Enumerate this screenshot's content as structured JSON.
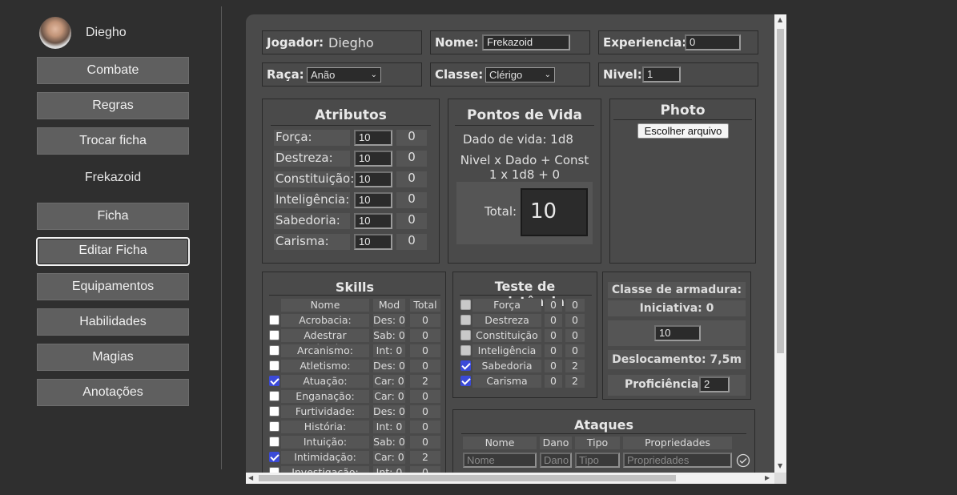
{
  "sidebar": {
    "user_name": "Diegho",
    "items": [
      {
        "label": "Combate"
      },
      {
        "label": "Regras"
      },
      {
        "label": "Trocar ficha"
      }
    ],
    "character_name": "Frekazoid",
    "char_items": [
      {
        "label": "Ficha"
      },
      {
        "label": "Editar Ficha"
      },
      {
        "label": "Equipamentos"
      },
      {
        "label": "Habilidades"
      },
      {
        "label": "Magias"
      },
      {
        "label": "Anotações"
      }
    ]
  },
  "header": {
    "player_label": "Jogador:",
    "player_value": "Diegho",
    "name_label": "Nome:",
    "name_value": "Frekazoid",
    "xp_label": "Experiencia:",
    "xp_value": "0",
    "race_label": "Raça:",
    "race_value": "Anão",
    "class_label": "Classe:",
    "class_value": "Clérigo",
    "level_label": "Nivel:",
    "level_value": "1"
  },
  "attributes": {
    "title": "Atributos",
    "rows": [
      {
        "label": "Força:",
        "value": "10",
        "mod": "0"
      },
      {
        "label": "Destreza:",
        "value": "10",
        "mod": "0"
      },
      {
        "label": "Constituição:",
        "value": "10",
        "mod": "0"
      },
      {
        "label": "Inteligência:",
        "value": "10",
        "mod": "0"
      },
      {
        "label": "Sabedoria:",
        "value": "10",
        "mod": "0"
      },
      {
        "label": "Carisma:",
        "value": "10",
        "mod": "0"
      }
    ]
  },
  "hp": {
    "title": "Pontos de Vida",
    "die_line": "Dado de vida:  1d8",
    "formula": "Nivel x Dado + Const",
    "formula_values": "1   x   1d8   +   0",
    "total_label": "Total:",
    "total_value": "10"
  },
  "photo": {
    "title": "Photo",
    "button": "Escolher arquivo"
  },
  "skills": {
    "title": "Skills",
    "headers": [
      "Nome",
      "Mod",
      "Total"
    ],
    "rows": [
      {
        "name": "Acrobacia:",
        "mod": "Des: 0",
        "total": "0",
        "checked": false
      },
      {
        "name": "Adestrar Animais:",
        "mod": "Sab: 0",
        "total": "0",
        "checked": false
      },
      {
        "name": "Arcanismo:",
        "mod": "Int: 0",
        "total": "0",
        "checked": false
      },
      {
        "name": "Atletismo:",
        "mod": "Des: 0",
        "total": "0",
        "checked": false
      },
      {
        "name": "Atuação:",
        "mod": "Car: 0",
        "total": "2",
        "checked": true
      },
      {
        "name": "Enganação:",
        "mod": "Car: 0",
        "total": "0",
        "checked": false
      },
      {
        "name": "Furtividade:",
        "mod": "Des: 0",
        "total": "0",
        "checked": false
      },
      {
        "name": "História:",
        "mod": "Int: 0",
        "total": "0",
        "checked": false
      },
      {
        "name": "Intuição:",
        "mod": "Sab: 0",
        "total": "0",
        "checked": false
      },
      {
        "name": "Intimidação:",
        "mod": "Car: 0",
        "total": "2",
        "checked": true
      },
      {
        "name": "Investigação:",
        "mod": "Int: 0",
        "total": "0",
        "checked": false
      }
    ]
  },
  "saves": {
    "title": "Teste de resistência",
    "rows": [
      {
        "name": "Força",
        "mod": "0",
        "total": "0",
        "checked": false
      },
      {
        "name": "Destreza",
        "mod": "0",
        "total": "0",
        "checked": false
      },
      {
        "name": "Constituição",
        "mod": "0",
        "total": "0",
        "checked": false
      },
      {
        "name": "Inteligência",
        "mod": "0",
        "total": "0",
        "checked": false
      },
      {
        "name": "Sabedoria",
        "mod": "0",
        "total": "2",
        "checked": true
      },
      {
        "name": "Carisma",
        "mod": "0",
        "total": "2",
        "checked": true
      }
    ]
  },
  "combat": {
    "armor_label": "Classe de armadura:",
    "initiative_label": "Iniciativa: 0",
    "armor_value": "10",
    "speed_label": "Deslocamento: 7,5m",
    "prof_label": "Proficiência:",
    "prof_value": "2"
  },
  "attacks": {
    "title": "Ataques",
    "headers": [
      "Nome",
      "Dano",
      "Tipo",
      "Propriedades"
    ],
    "placeholders": [
      "Nome",
      "Dano",
      "Tipo",
      "Propriedades"
    ]
  }
}
